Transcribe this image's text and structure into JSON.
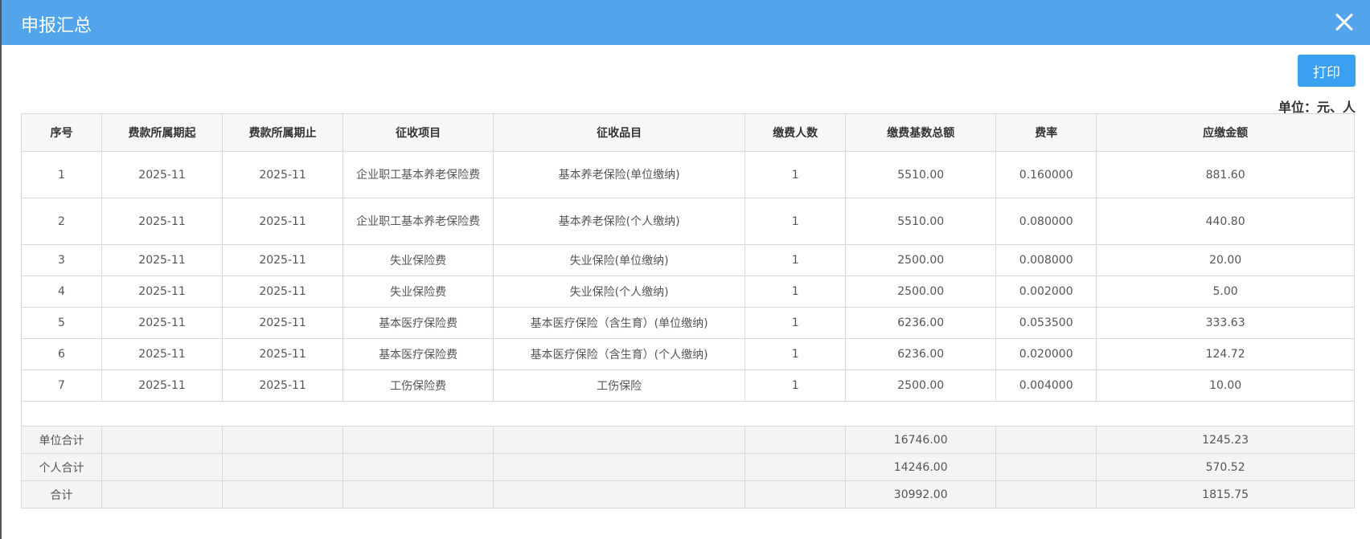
{
  "dialog": {
    "title": "申报汇总",
    "print_label": "打印",
    "unit_label": "单位：元、人"
  },
  "table": {
    "headers": [
      "序号",
      "费款所属期起",
      "费款所属期止",
      "征收项目",
      "征收品目",
      "缴费人数",
      "缴费基数总额",
      "费率",
      "应缴金额"
    ],
    "rows": [
      [
        "1",
        "2025-11",
        "2025-11",
        "企业职工基本养老保险费",
        "基本养老保险(单位缴纳)",
        "1",
        "5510.00",
        "0.160000",
        "881.60"
      ],
      [
        "2",
        "2025-11",
        "2025-11",
        "企业职工基本养老保险费",
        "基本养老保险(个人缴纳)",
        "1",
        "5510.00",
        "0.080000",
        "440.80"
      ],
      [
        "3",
        "2025-11",
        "2025-11",
        "失业保险费",
        "失业保险(单位缴纳)",
        "1",
        "2500.00",
        "0.008000",
        "20.00"
      ],
      [
        "4",
        "2025-11",
        "2025-11",
        "失业保险费",
        "失业保险(个人缴纳)",
        "1",
        "2500.00",
        "0.002000",
        "5.00"
      ],
      [
        "5",
        "2025-11",
        "2025-11",
        "基本医疗保险费",
        "基本医疗保险（含生育）(单位缴纳)",
        "1",
        "6236.00",
        "0.053500",
        "333.63"
      ],
      [
        "6",
        "2025-11",
        "2025-11",
        "基本医疗保险费",
        "基本医疗保险（含生育）(个人缴纳)",
        "1",
        "6236.00",
        "0.020000",
        "124.72"
      ],
      [
        "7",
        "2025-11",
        "2025-11",
        "工伤保险费",
        "工伤保险",
        "1",
        "2500.00",
        "0.004000",
        "10.00"
      ]
    ],
    "totals": [
      {
        "label": "单位合计",
        "base_total": "16746.00",
        "amount": "1245.23"
      },
      {
        "label": "个人合计",
        "base_total": "14246.00",
        "amount": "570.52"
      },
      {
        "label": "合计",
        "base_total": "30992.00",
        "amount": "1815.75"
      }
    ]
  },
  "icons": {
    "close": "close-icon"
  },
  "colors": {
    "titlebar": "#52a5ea",
    "print_button": "#3aa0f0"
  }
}
